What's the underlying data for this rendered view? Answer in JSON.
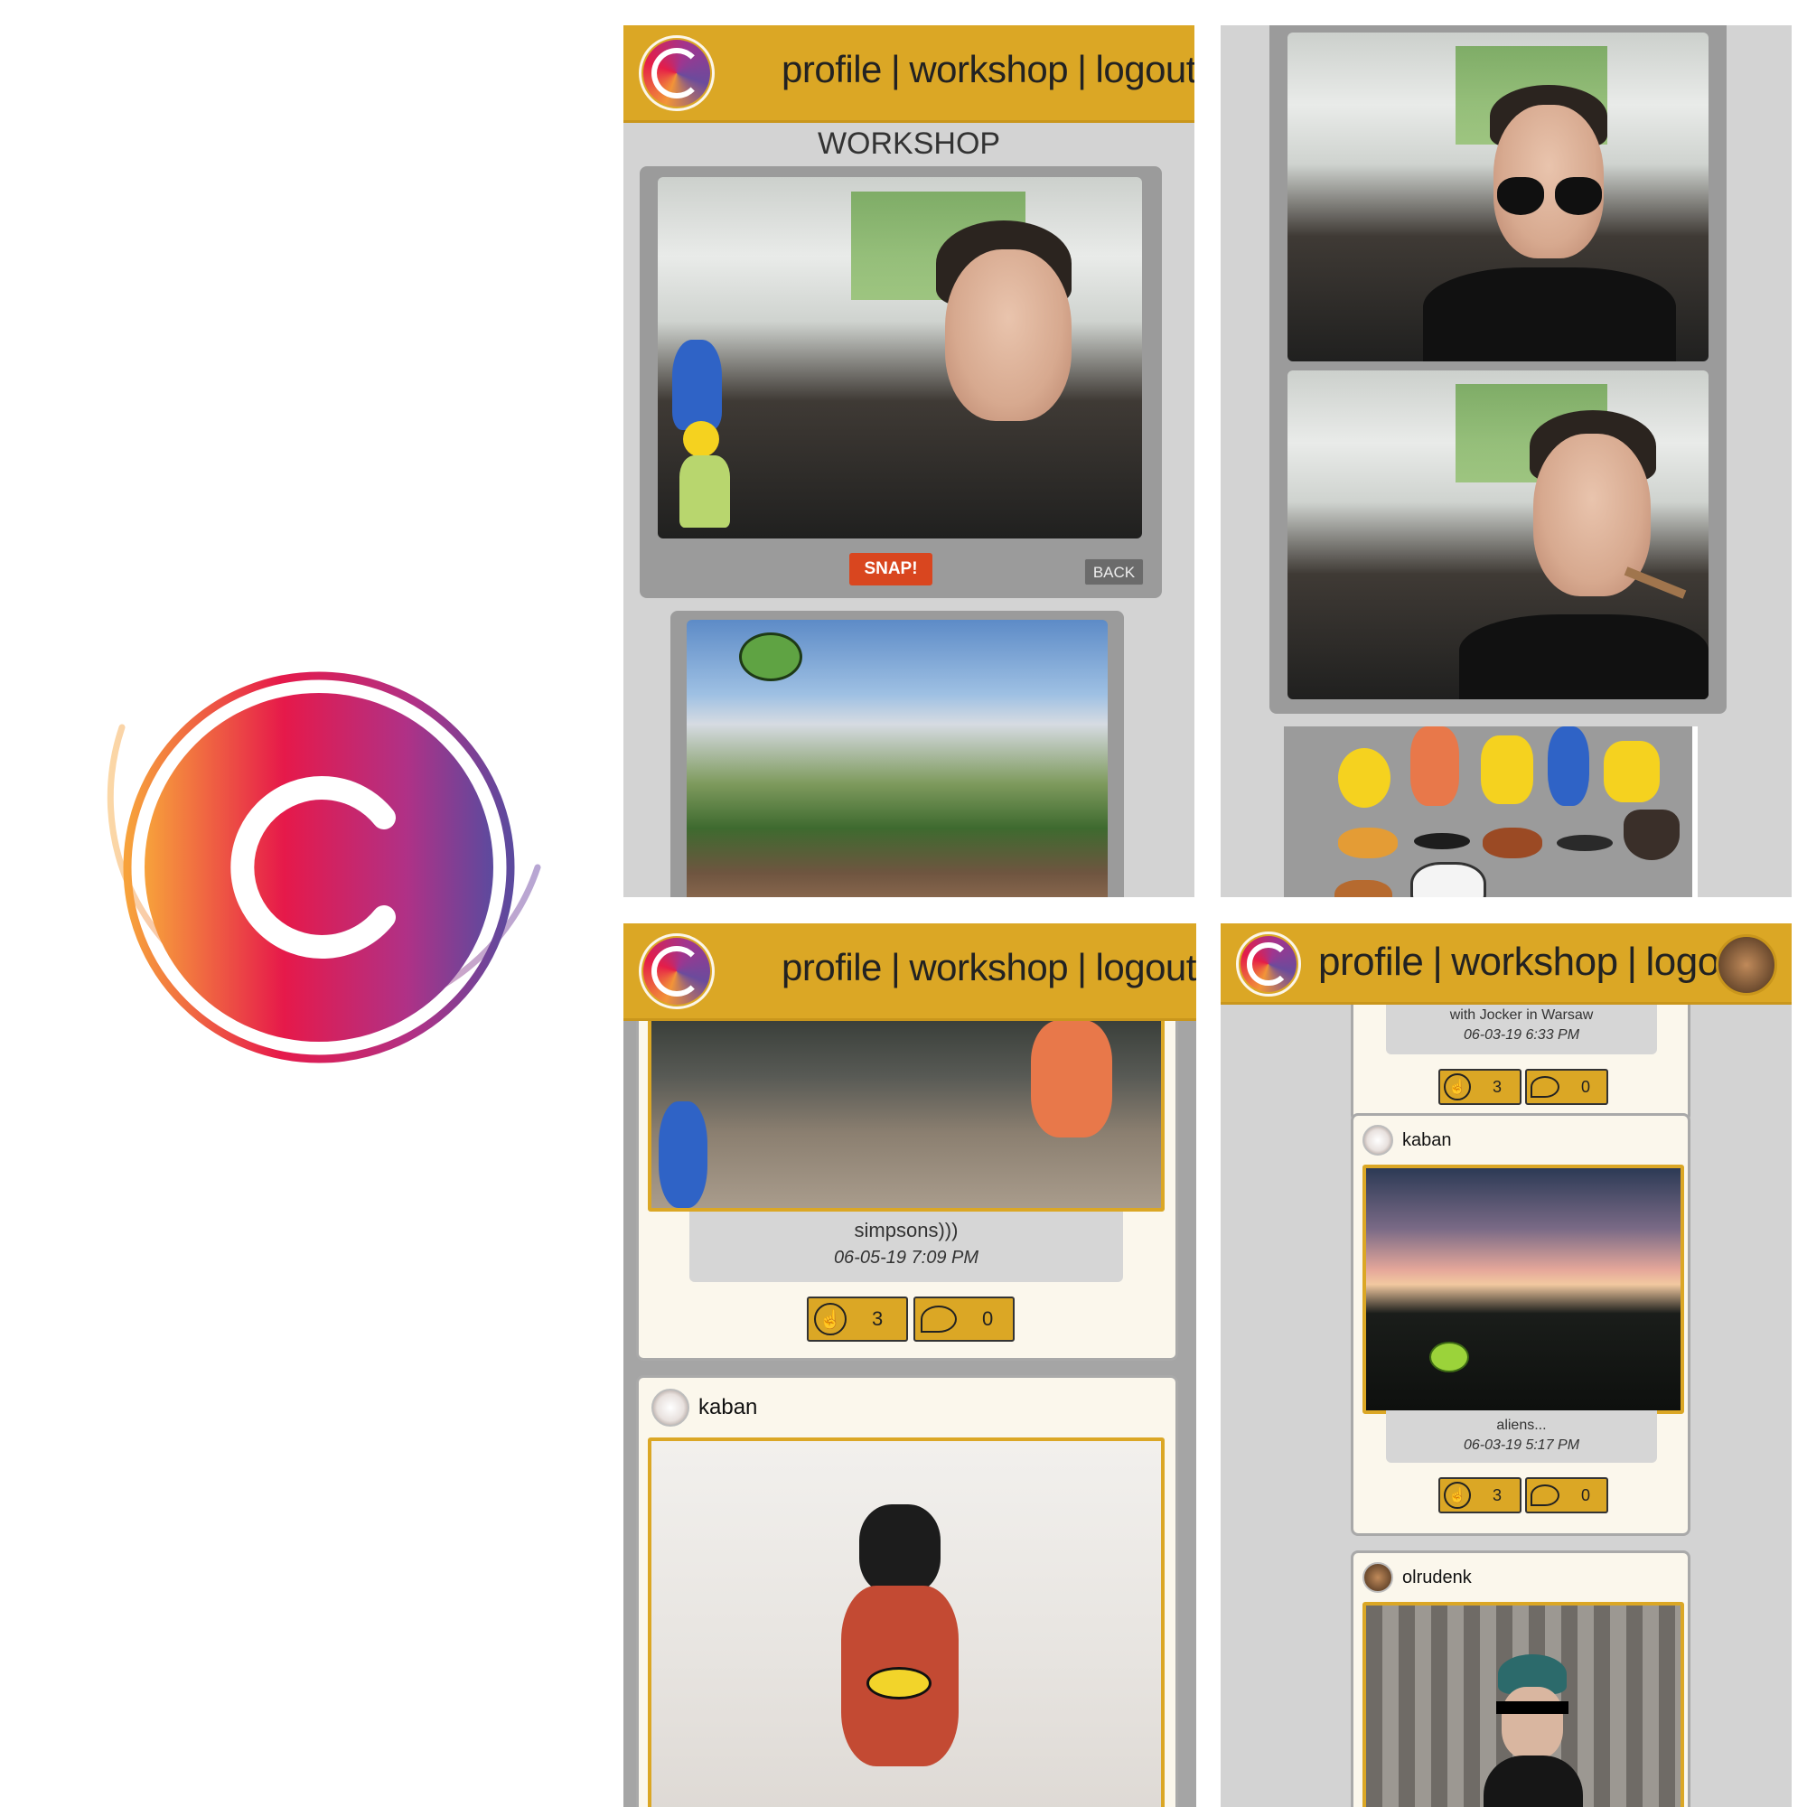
{
  "colors": {
    "header_gold": "#dba725",
    "snap_red": "#d9461f",
    "panel_gray": "#d3d3d3"
  },
  "nav": {
    "profile": "profile",
    "sep": "|",
    "workshop": "workshop",
    "logout": "logout"
  },
  "workshop": {
    "title": "WORKSHOP",
    "snap_label": "SNAP!",
    "back_label": "BACK"
  },
  "feed_left": {
    "post1": {
      "caption": "simpsons)))",
      "date": "06-05-19 7:09 PM",
      "likes": "3",
      "comments": "0"
    },
    "post2": {
      "username": "kaban"
    }
  },
  "feed_right": {
    "post0": {
      "caption": "with Jocker in Warsaw",
      "date": "06-03-19 6:33 PM",
      "likes": "3",
      "comments": "0"
    },
    "post1": {
      "username": "kaban",
      "caption": "aliens...",
      "date": "06-03-19 5:17 PM",
      "likes": "3",
      "comments": "0"
    },
    "post2": {
      "username": "olrudenk"
    }
  },
  "icons": {
    "like": "thumbs-up-icon",
    "comment": "speech-bubble-icon",
    "logo": "camagru-c-logo"
  }
}
